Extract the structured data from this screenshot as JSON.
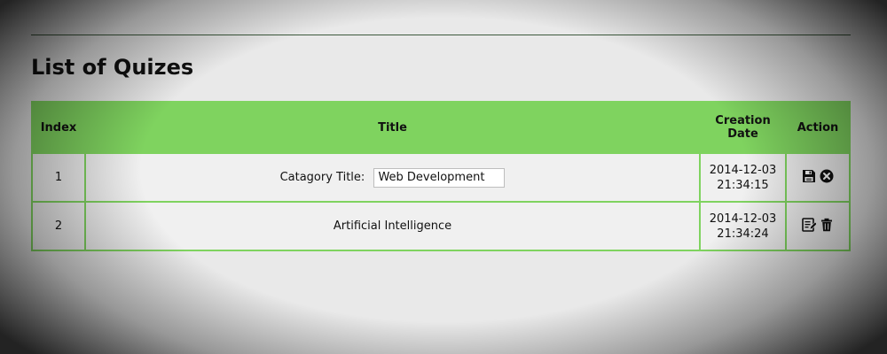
{
  "page": {
    "title": "List of Quizes"
  },
  "table": {
    "headers": {
      "index": "Index",
      "title": "Title",
      "creation_date": "Creation Date",
      "action": "Action"
    },
    "rows": [
      {
        "index": "1",
        "title_label": "Catagory Title:",
        "title_value": "Web Development",
        "date": "2014-12-03",
        "time": "21:34:15",
        "actions": [
          "save-icon",
          "cancel-icon"
        ]
      },
      {
        "index": "2",
        "title": "Artificial Intelligence",
        "date": "2014-12-03",
        "time": "21:34:24",
        "actions": [
          "edit-icon",
          "delete-icon"
        ]
      }
    ]
  },
  "colors": {
    "header_green": "#7fd35f",
    "rule": "#3d5a3d"
  }
}
